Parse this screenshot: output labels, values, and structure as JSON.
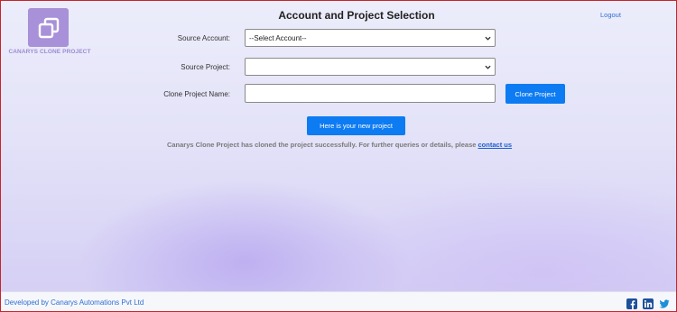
{
  "header": {
    "logo_text": "CANARYS CLONE PROJECT",
    "title": "Account and Project Selection",
    "logout_label": "Logout"
  },
  "form": {
    "source_account": {
      "label": "Source Account:",
      "value": "--Select Account--"
    },
    "source_project": {
      "label": "Source Project:",
      "value": ""
    },
    "clone_name": {
      "label": "Clone Project Name:",
      "value": "",
      "button_label": "Clone Project"
    }
  },
  "result": {
    "button_label": "Here is your new project",
    "message": "Canarys Clone Project has cloned the project successfully. For further queries or details, please ",
    "link_label": "contact us"
  },
  "footer": {
    "text": "Developed by Canarys Automations Pvt Ltd",
    "social_icons": [
      "facebook-icon",
      "linkedin-icon",
      "twitter-icon"
    ]
  },
  "colors": {
    "primary_button": "#0d7bf2",
    "logo_bg": "#a891d8",
    "link": "#2f6fd0",
    "border_accent": "#c9232d"
  }
}
